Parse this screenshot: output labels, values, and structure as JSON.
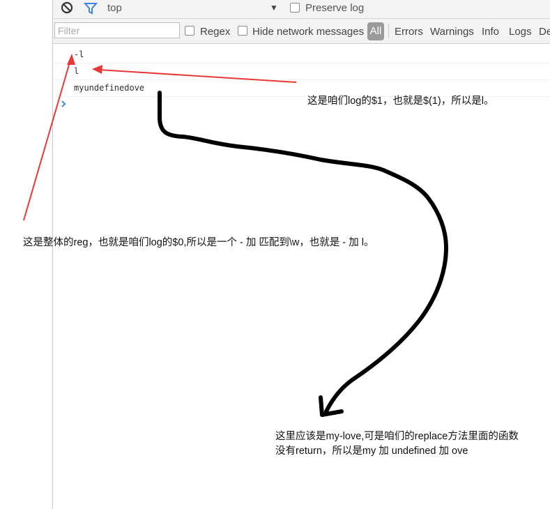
{
  "toolbar": {
    "context": "top",
    "preserve_log_label": "Preserve log"
  },
  "filterbar": {
    "filter_placeholder": "Filter",
    "regex_label": "Regex",
    "hide_network_label": "Hide network messages",
    "all_label": "All",
    "levels": [
      "Errors",
      "Warnings",
      "Info",
      "Logs",
      "De"
    ]
  },
  "console": {
    "lines": [
      "-l",
      "l",
      "myundefinedove"
    ]
  },
  "annotations": {
    "note_dollar1": "这是咱们log的$1，也就是$(1)，所以是l。",
    "note_dollar0": "这是整体的reg，也就是咱们log的$0,所以是一个 - 加 匹配到\\w，也就是 - 加 l。",
    "note_replace_line1": "这里应该是my-love,可是咱们的replace方法里面的函数",
    "note_replace_line2": "没有return，所以是my 加 undefined 加 ove"
  },
  "colors": {
    "arrow_red": "#e8393a",
    "brush_black": "#000000",
    "filter_blue": "#3b86e8"
  }
}
